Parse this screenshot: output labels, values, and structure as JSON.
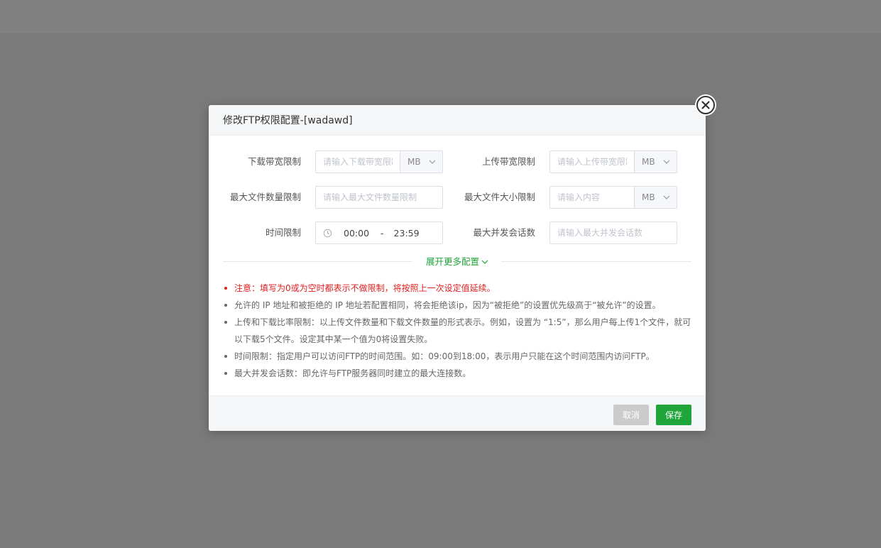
{
  "dialog": {
    "title": "修改FTP权限配置-[wadawd]"
  },
  "form": {
    "download_limit": {
      "label": "下载带宽限制",
      "placeholder": "请输入下载带宽限制",
      "value": "",
      "unit": "MB"
    },
    "upload_limit": {
      "label": "上传带宽限制",
      "placeholder": "请输入上传带宽限制",
      "value": "",
      "unit": "MB"
    },
    "max_file_count": {
      "label": "最大文件数量限制",
      "placeholder": "请输入最大文件数量限制",
      "value": ""
    },
    "max_file_size": {
      "label": "最大文件大小限制",
      "placeholder": "请输入内容",
      "value": "",
      "unit": "MB"
    },
    "time_limit": {
      "label": "时间限制",
      "start": "00:00",
      "separator": "-",
      "end": "23:59"
    },
    "max_sessions": {
      "label": "最大并发会话数",
      "placeholder": "请输入最大并发会话数",
      "value": ""
    }
  },
  "expand_label": "展开更多配置",
  "notes": [
    "注意：填写为0或为空时都表示不做限制，将按照上一次设定值延续。",
    "允许的 IP 地址和被拒绝的 IP 地址若配置相同，将会拒绝该ip，因为“被拒绝”的设置优先级高于“被允许”的设置。",
    "上传和下载比率限制：以上传文件数量和下载文件数量的形式表示。例如，设置为 “1:5”，那么用户每上传1个文件，就可以下载5个文件。设定其中某一个值为0将设置失败。",
    "时间限制：指定用户可以访问FTP的时间范围。如：09:00到18:00，表示用户只能在这个时间范围内访问FTP。",
    "最大并发会话数：即允许与FTP服务器同时建立的最大连接数。"
  ],
  "footer": {
    "cancel_label": "取消",
    "save_label": "保存"
  },
  "colors": {
    "accent": "#20a53a",
    "warning": "#e02020",
    "overlay": "#7a7a7a"
  }
}
